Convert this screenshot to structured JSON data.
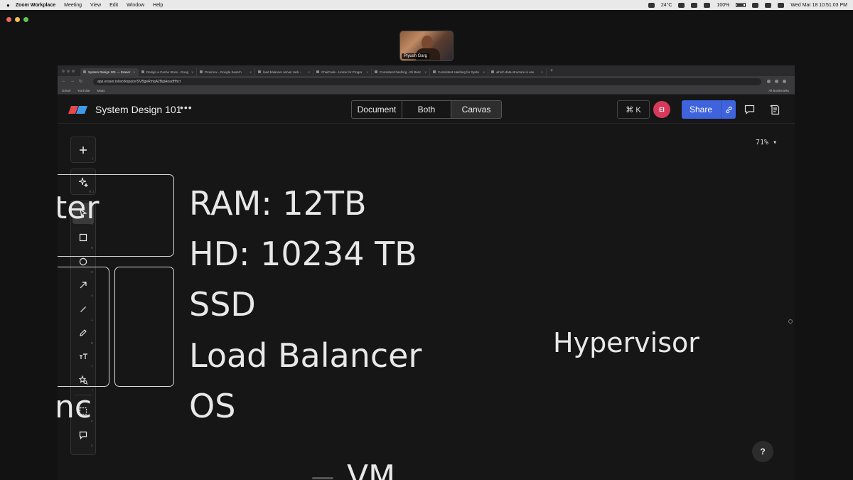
{
  "menubar": {
    "app_name": "Zoom Workplace",
    "menus": [
      "Meeting",
      "View",
      "Edit",
      "Window",
      "Help"
    ],
    "temperature": "24°C",
    "battery": "100%",
    "datetime": "Wed Mar 18  10:51:03 PM"
  },
  "zoom": {
    "participant_name": "Piyush Garg"
  },
  "browser": {
    "tabs": [
      {
        "label": "System Design 101 — Eraser",
        "active": true
      },
      {
        "label": "Design a Cache Store - Goog",
        "active": false
      },
      {
        "label": "Proxmox - Google Search",
        "active": false
      },
      {
        "label": "load balancer server rack -",
        "active": false
      },
      {
        "label": "ChaiCode - Home for Progra",
        "active": false
      },
      {
        "label": "Consistent hashing - Eli Benr",
        "active": false
      },
      {
        "label": "Consistent Hashing for Syste",
        "active": false
      },
      {
        "label": "which data structure is use",
        "active": false
      }
    ],
    "url": "app.eraser.io/workspace/SVBgeRmqA2BgiAoadHhct",
    "bookmarks": [
      "Gmail",
      "YouTube",
      "Maps"
    ],
    "all_bookmarks": "All Bookmarks"
  },
  "app": {
    "doc_title": "System Design 101",
    "more": "•••",
    "view_modes": [
      "Document",
      "Both",
      "Canvas"
    ],
    "active_view": "Canvas",
    "command_k": "⌘ K",
    "avatar_initials": "EI",
    "share_label": "Share",
    "zoom_level": "71%",
    "help": "?"
  },
  "toolbar": {
    "add_key": "/",
    "ai_key": "R J",
    "tools": [
      {
        "name": "select",
        "key": "V"
      },
      {
        "name": "rectangle",
        "key": "R"
      },
      {
        "name": "ellipse",
        "key": "O"
      },
      {
        "name": "arrow",
        "key": "A"
      },
      {
        "name": "line",
        "key": "L"
      },
      {
        "name": "pencil",
        "key": "D"
      },
      {
        "name": "text",
        "key": "T"
      },
      {
        "name": "icon-search",
        "key": "I"
      },
      {
        "name": "frame",
        "key": "F"
      },
      {
        "name": "comment",
        "key": "C"
      }
    ]
  },
  "canvas": {
    "partial_text_top": "ter",
    "partial_text_bottom": "nc",
    "specs": [
      "RAM: 12TB",
      "HD: 10234 TB",
      "SSD",
      "Load Balancer",
      "OS"
    ],
    "hypervisor": "Hypervisor",
    "bottom_text": "VM"
  },
  "colors": {
    "share_blue": "#3e63dd",
    "avatar_red": "#d63a5a",
    "background": "#161616"
  }
}
